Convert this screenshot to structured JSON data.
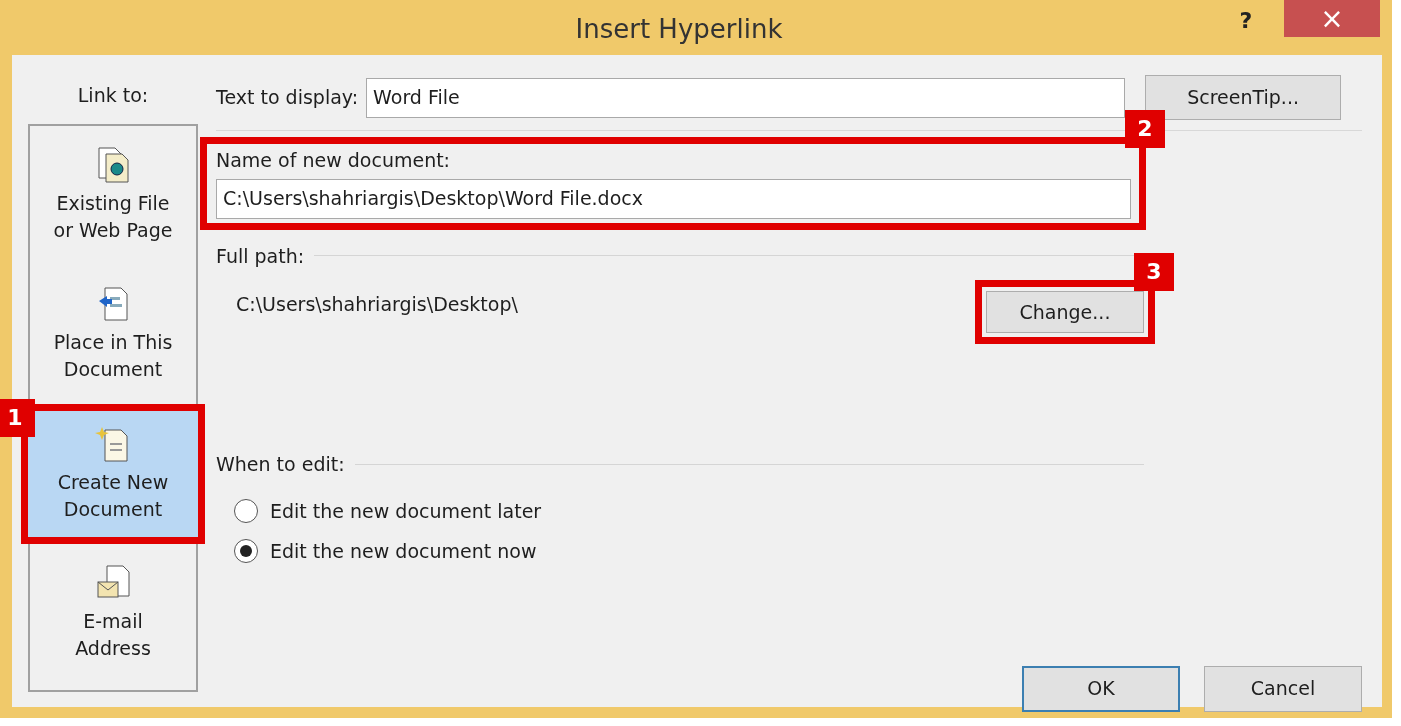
{
  "window": {
    "title": "Insert Hyperlink",
    "help": "?",
    "close": "×"
  },
  "link_to": {
    "label": "Link to:",
    "items": [
      {
        "kind": "existing",
        "label": "Existing File or Web Page",
        "selected": false
      },
      {
        "kind": "place",
        "label": "Place in This Document",
        "selected": false
      },
      {
        "kind": "new",
        "label": "Create New Document",
        "selected": true,
        "callout": {
          "number": "1"
        }
      },
      {
        "kind": "email",
        "label": "E-mail Address",
        "selected": false
      }
    ]
  },
  "text_to_display": {
    "label": "Text to display:",
    "value": "Word File"
  },
  "screentip_button": "ScreenTip...",
  "new_document": {
    "label": "Name of new document:",
    "value": "C:\\Users\\shahriargis\\Desktop\\Word File.docx",
    "callout": {
      "number": "2"
    }
  },
  "full_path": {
    "label": "Full path:",
    "value": "C:\\Users\\shahriargis\\Desktop\\"
  },
  "change_button": {
    "label": "Change...",
    "callout": {
      "number": "3"
    }
  },
  "when_to_edit": {
    "label": "When to edit:",
    "options": [
      {
        "label": "Edit the new document later",
        "selected": false
      },
      {
        "label": "Edit the new document now",
        "selected": true
      }
    ]
  },
  "buttons": [
    {
      "label": "OK",
      "default": true
    },
    {
      "label": "Cancel",
      "default": false
    }
  ]
}
